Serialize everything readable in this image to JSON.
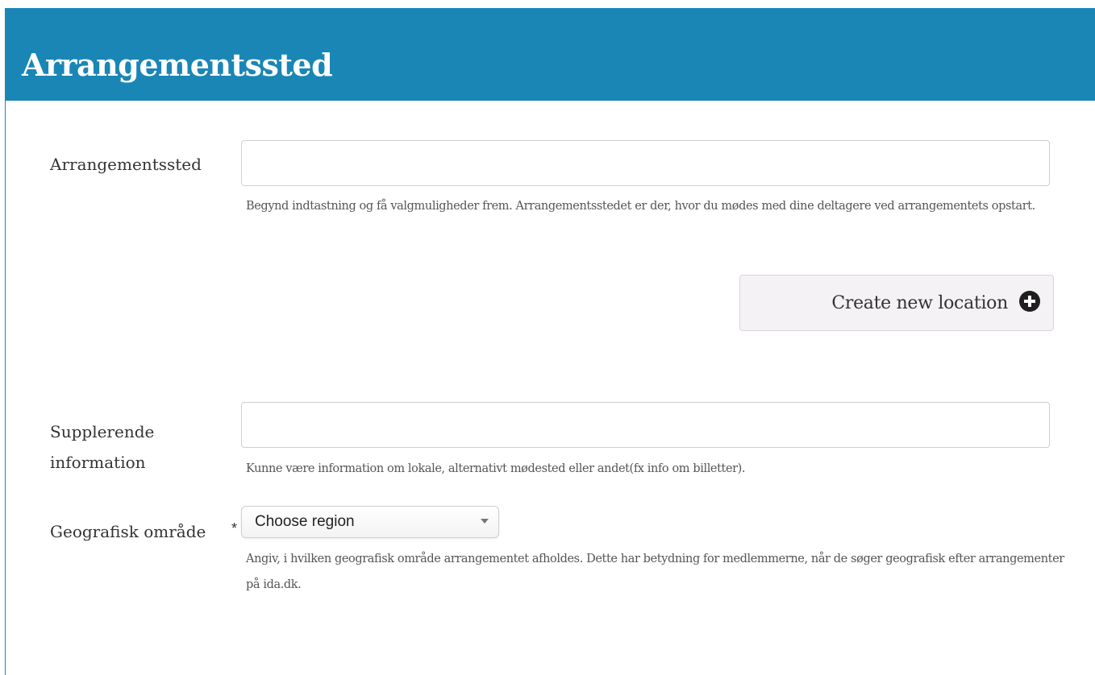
{
  "header": {
    "title": "Arrangementssted"
  },
  "fields": {
    "venue": {
      "label": "Arrangementssted",
      "value": "",
      "help": "Begynd indtastning og få valgmuligheder frem. Arrangementsstedet er der, hvor du mødes med dine deltagere ved arrangementets opstart."
    },
    "create_location": {
      "label": "Create new location",
      "icon": "plus-circle-icon"
    },
    "supplementary": {
      "label_line1": "Supplerende",
      "label_line2": "information",
      "value": "",
      "help": "Kunne være information om lokale, alternativt mødested eller andet(fx info om billetter)."
    },
    "region": {
      "label": "Geografisk område",
      "required_marker": "*",
      "selected": "Choose region",
      "help": "Angiv, i hvilken geografisk område arrangementet afholdes. Dette har betydning for medlemmerne, når de søger geografisk efter arrangementer på ida.dk."
    }
  },
  "colors": {
    "header_bg": "#1a86b5",
    "header_text": "#ffffff",
    "button_bg": "#f5f2f6"
  }
}
